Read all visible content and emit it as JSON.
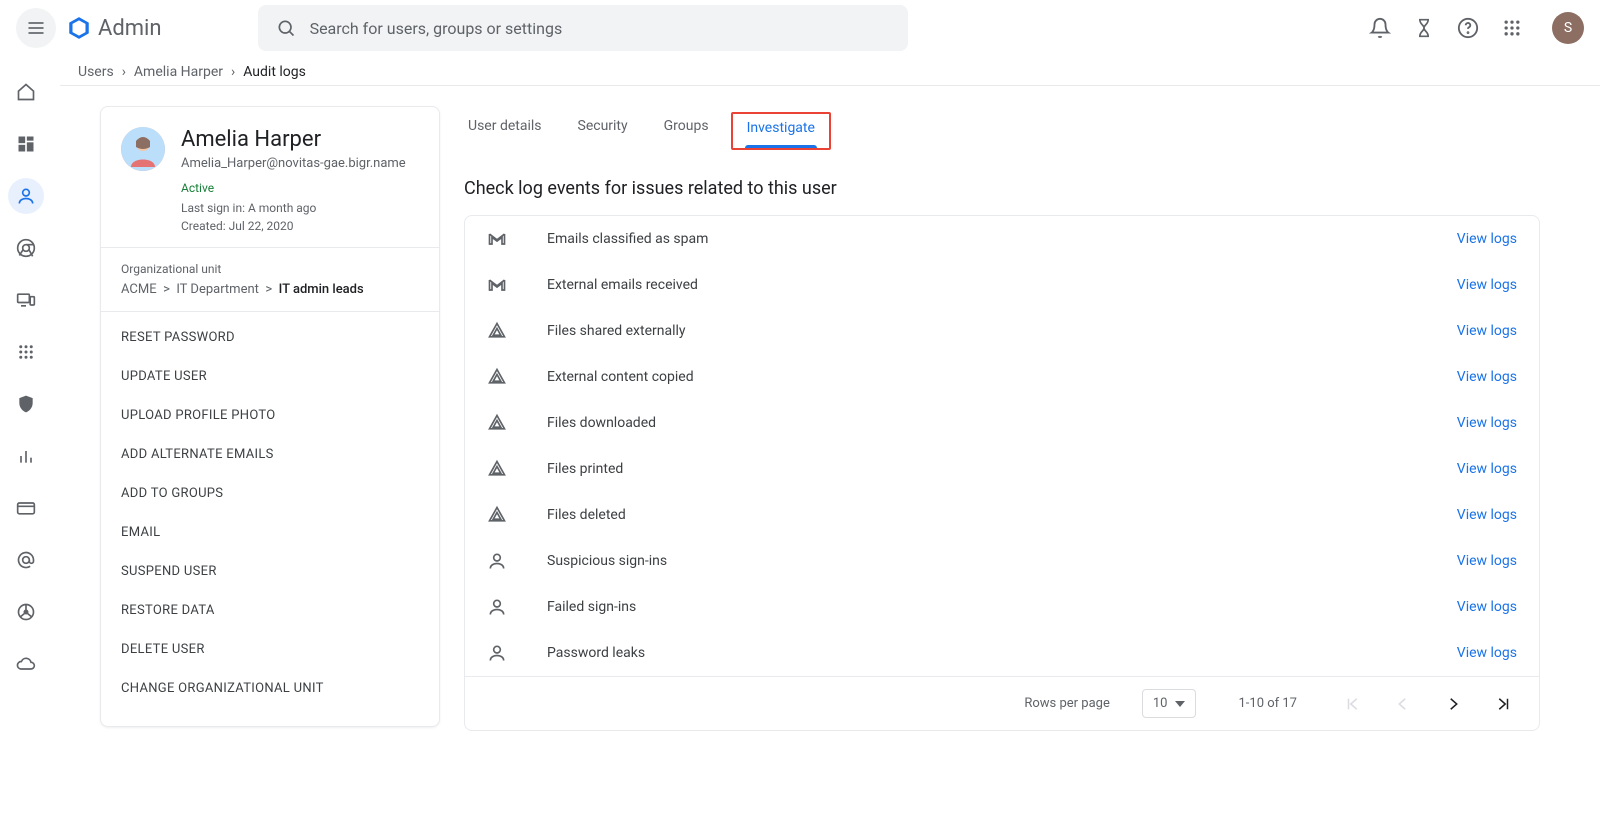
{
  "app_name": "Admin",
  "search_placeholder": "Search for users, groups or settings",
  "avatar_initial": "S",
  "breadcrumb": {
    "items": [
      "Users",
      "Amelia Harper"
    ],
    "current": "Audit logs"
  },
  "user": {
    "name": "Amelia Harper",
    "email": "Amelia_Harper@novitas-gae.bigr.name",
    "status": "Active",
    "last_signin": "Last sign in: A month ago",
    "created": "Created: Jul 22, 2020"
  },
  "org_unit": {
    "label": "Organizational unit",
    "path": [
      "ACME",
      "IT Department"
    ],
    "current": "IT admin leads"
  },
  "actions": [
    "RESET PASSWORD",
    "UPDATE USER",
    "UPLOAD PROFILE PHOTO",
    "ADD ALTERNATE EMAILS",
    "ADD TO GROUPS",
    "EMAIL",
    "SUSPEND USER",
    "RESTORE DATA",
    "DELETE USER",
    "CHANGE ORGANIZATIONAL UNIT"
  ],
  "tabs": [
    "User details",
    "Security",
    "Groups",
    "Investigate"
  ],
  "active_tab": "Investigate",
  "section_title": "Check log events for issues related to this user",
  "log_rows": [
    {
      "icon": "gmail",
      "label": "Emails classified as spam"
    },
    {
      "icon": "gmail",
      "label": "External emails received"
    },
    {
      "icon": "drive",
      "label": "Files shared externally"
    },
    {
      "icon": "drive",
      "label": "External content copied"
    },
    {
      "icon": "drive",
      "label": "Files downloaded"
    },
    {
      "icon": "drive",
      "label": "Files printed"
    },
    {
      "icon": "drive",
      "label": "Files deleted"
    },
    {
      "icon": "user",
      "label": "Suspicious sign-ins"
    },
    {
      "icon": "user",
      "label": "Failed sign-ins"
    },
    {
      "icon": "user",
      "label": "Password leaks"
    }
  ],
  "view_logs_label": "View logs",
  "pager": {
    "rows_per_page_label": "Rows per page",
    "rows_per_page_value": "10",
    "range": "1-10 of 17"
  }
}
